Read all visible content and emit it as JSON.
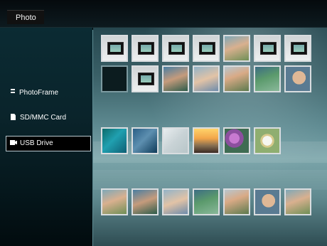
{
  "header": {
    "title": "Photo"
  },
  "sidebar": {
    "items": [
      {
        "label": "PhotoFrame",
        "icon": "list-icon",
        "selected": false
      },
      {
        "label": "SD/MMC Card",
        "icon": "card-icon",
        "selected": false
      },
      {
        "label": "USB Drive",
        "icon": "usb-icon",
        "selected": true
      }
    ]
  },
  "colors": {
    "selection_border": "#b9c9cf",
    "sidebar_top": "#0b2b33",
    "content_mid": "#7ba5aa",
    "divider": "#7fb8c2"
  }
}
